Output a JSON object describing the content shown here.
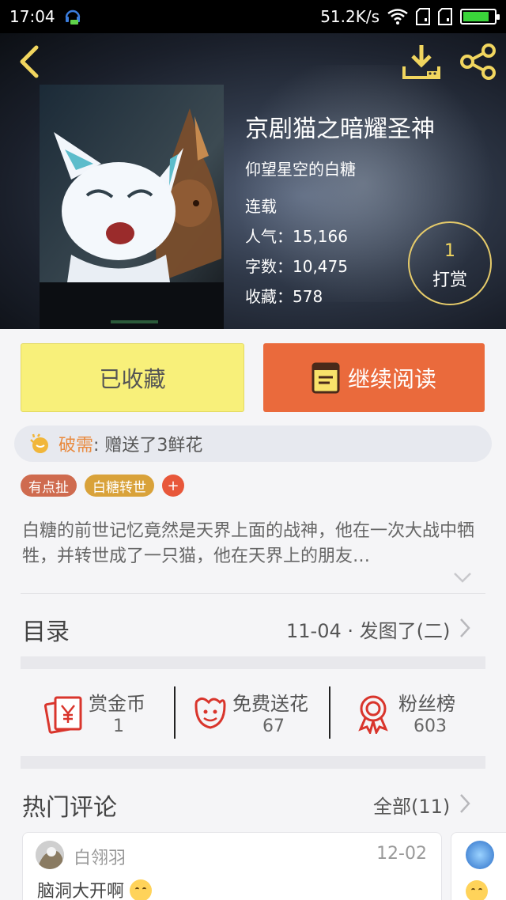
{
  "status_bar": {
    "time": "17:04",
    "network_speed": "51.2K/s",
    "icons": [
      "headset-app-icon",
      "wifi-icon",
      "sim-card-icon",
      "sim-card-icon",
      "battery-icon"
    ],
    "battery_level": 0.85
  },
  "header": {
    "icons": [
      "back-chevron-icon",
      "download-icon",
      "share-icon"
    ],
    "accent": "#f1d65f"
  },
  "book": {
    "title": "京剧猫之暗耀圣神",
    "author": "仰望星空的白糖",
    "status": "连载",
    "stats": [
      {
        "label": "人气：",
        "value": "15,166"
      },
      {
        "label": "字数：",
        "value": "10,475"
      },
      {
        "label": "收藏：",
        "value": "578"
      }
    ],
    "tip": {
      "count": "1",
      "label": "打赏"
    }
  },
  "actions": {
    "collected_label": "已收藏",
    "read_label": "继续阅读",
    "collected_color": "#f8f07a",
    "read_color": "#ea6a3c"
  },
  "gift": {
    "icon": "thumbs-up-icon",
    "user": "破需",
    "text": " : 赠送了3鲜花"
  },
  "tags": [
    {
      "label": "有点扯",
      "color": "#cf6b4f"
    },
    {
      "label": "白糖转世",
      "color": "#d9a23a"
    }
  ],
  "tag_add_label": "+",
  "synopsis": "白糖的前世记忆竟然是天界上面的战神，他在一次大战中牺牲，并转世成了一只猫，他在天界上的朋友…",
  "toc": {
    "title": "目录",
    "latest": "11-04 · 发图了(二)"
  },
  "reward_items": [
    {
      "label": "赏金币",
      "value": "1",
      "icon": "red-envelope-icon"
    },
    {
      "label": "免费送花",
      "value": "67",
      "icon": "flower-icon"
    },
    {
      "label": "粉丝榜",
      "value": "603",
      "icon": "medal-icon"
    }
  ],
  "hot_comments": {
    "title": "热门评论",
    "all_label": "全部(11)",
    "items": [
      {
        "user": "白翎羽",
        "date": "12-02",
        "text": "脑洞大开啊"
      }
    ]
  }
}
